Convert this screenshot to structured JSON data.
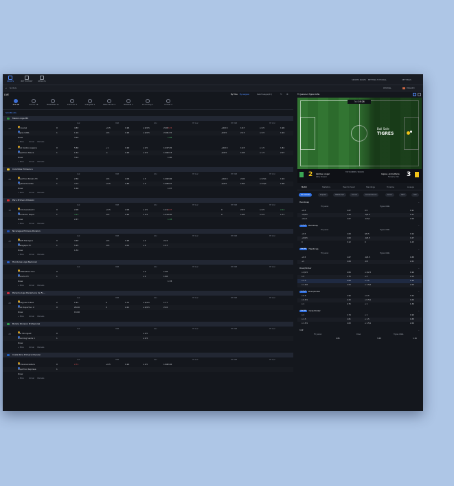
{
  "nav": {
    "sports": "SPORTS",
    "bet_history": "BET HISTORY",
    "results": "RESULTS",
    "sports_rules": "SPORTS RULES",
    "betting_tutorial": "BETTING TUTORIAL",
    "settings": "SETTINGS",
    "no_bets": "No Bets",
    "odds_format": "DECIMAL",
    "language": "ENGLISH"
  },
  "live": {
    "title": "LIVE",
    "sort": "By Time",
    "sort_alt": "By Leagues",
    "select_league": "Select League(11)",
    "soccer_label": "SOCCER (18)"
  },
  "sport_tabs": [
    {
      "label": "ALL 38",
      "active": true
    },
    {
      "label": "Soccer 18"
    },
    {
      "label": "Basketball 11"
    },
    {
      "label": "E-Soccer 4"
    },
    {
      "label": "Volleyball 1"
    },
    {
      "label": "Table Tennis 4"
    },
    {
      "label": "Baseball 1"
    },
    {
      "label": "Ice Hockey 1"
    },
    {
      "label": "Cricket 3"
    }
  ],
  "col_headers": [
    "1x2",
    "HDP",
    "O/U",
    "HT 1x2",
    "HT HDP",
    "HT O/U"
  ],
  "more_label": "+ More",
  "corner_label": "Corner",
  "intervals_label": "Intervals",
  "leagues": [
    {
      "name": "Mexico Liga MX",
      "matches": [
        {
          "time": "2H 74:30",
          "home": "FC Juarez",
          "away": "Tigres UANL",
          "hs": "0",
          "as": "1",
          "r1": [
            "4.83",
            "",
            "+0.5",
            "1.96",
            "o 2/2.5",
            "2.06",
            "3.15",
            "",
            "+0/0.5",
            "1.67",
            "o 0.5",
            "1.96"
          ],
          "r2": [
            "1.16",
            "",
            "-0.5",
            "1.96",
            "u 2/2.5",
            "2.06",
            "1.55",
            "",
            "-0/0.5",
            "2.23",
            "u 0.5",
            "1.94"
          ],
          "draw": [
            "3.29",
            "",
            "",
            "",
            "",
            "",
            "1.68",
            "",
            "",
            "",
            "",
            ""
          ]
        },
        {
          "time": "2H 36:30",
          "home": "Club Santos Laguna",
          "away": "Deportivo Toluca",
          "hs": "0",
          "as": "1",
          "r1": [
            "5.80",
            "",
            "+1",
            "1.99",
            "o 2.5",
            "1.92",
            "7.05",
            "",
            "+0/0.5",
            "1.93",
            "o 1.5",
            "1.81"
          ],
          "r2": [
            "1.54",
            "",
            "-1",
            "1.99",
            "u 2.5",
            "1.96",
            "2.53",
            "",
            "-0/0.5",
            "1.98",
            "u 1.5",
            "2.07"
          ],
          "draw": [
            "3.14",
            "",
            "",
            "",
            "",
            "",
            "1.90",
            "",
            "",
            "",
            "",
            ""
          ]
        }
      ]
    },
    {
      "name": "Colombia Primera A",
      "matches": [
        {
          "time": "2H 09:30",
          "home": "Deportivo Pereira FC",
          "away": "Aguilas Doradas",
          "hs": "0",
          "as": "1",
          "r1": [
            "2.56",
            "",
            "-0.5",
            "2.06",
            "o 3",
            "1.96",
            "2.86",
            "",
            "+0/0.5",
            "2.06",
            "o 0.5/1",
            "1.94"
          ],
          "r2": [
            "3.72",
            "",
            "+0.5",
            "1.86",
            "u 3",
            "1.98",
            "3.87",
            "",
            "-0/0.5",
            "1.86",
            "u 0.5/1",
            "1.96"
          ],
          "draw": [
            "1.60",
            "",
            "",
            "",
            "",
            "",
            "1.97",
            "",
            "",
            "",
            "",
            ""
          ]
        }
      ]
    },
    {
      "name": "Peru Primera Division",
      "matches": [
        {
          "time": "1H 33:00",
          "home": "CD Universidad C",
          "away": "Asociacion Depor",
          "hs": "0",
          "as": "1",
          "r1": [
            "2.06",
            "",
            "+0.5",
            "2.06",
            "o 1.5",
            "1.91",
            "4.07",
            "",
            "0",
            "2.45",
            "o 0.5",
            "2.14"
          ],
          "r2": [
            "4.11",
            "",
            "-0.5",
            "1.92",
            "u 1.5",
            "1.91",
            "4.60",
            "",
            "0",
            "1.96",
            "u 0.5",
            "1.71"
          ],
          "draw": [
            "2.47",
            "",
            "",
            "",
            "",
            "",
            "1.38",
            "",
            "",
            "",
            "",
            ""
          ]
        }
      ]
    },
    {
      "name": "Nicaragua Primera Division",
      "matches": [
        {
          "time": "2H 76:30",
          "home": "UNAN Managua",
          "away": "Matagalpa FC",
          "hs": "0",
          "as": "1",
          "r1": [
            "3.48",
            "",
            "-0.5",
            "1.96",
            "o 2",
            "2.22",
            "",
            "",
            "",
            "",
            "",
            ""
          ],
          "r2": [
            "5.25",
            "",
            "-0.5",
            "2.01",
            "u 2",
            "1.57",
            "",
            "",
            "",
            "",
            "",
            ""
          ],
          "draw": [
            "1.32",
            "",
            "",
            "",
            "",
            "",
            "",
            "",
            "",
            "",
            "",
            ""
          ]
        }
      ]
    },
    {
      "name": "Honduras Liga Nacional",
      "matches": [
        {
          "time": "",
          "home": "CD Marathon San",
          "away": "Olancho FC",
          "hs": "0",
          "as": "1",
          "r1": [
            "",
            "",
            "",
            "",
            "o 2",
            "1.96",
            "",
            "",
            "",
            "",
            "",
            ""
          ],
          "r2": [
            "",
            "",
            "",
            "",
            "u 2",
            "1.86",
            "",
            "",
            "",
            "",
            "",
            ""
          ],
          "draw": [
            "",
            "",
            "",
            "",
            "",
            "",
            "1.78",
            "",
            "",
            "",
            "",
            ""
          ]
        }
      ]
    },
    {
      "name": "Panama Liga Panamena de Fu...",
      "matches": [
        {
          "time": "2H 65:30",
          "home": "Veraguas United",
          "away": "Club Deportivo U",
          "hs": "2",
          "as": "0",
          "r1": [
            "1.61",
            "",
            "0",
            "1.72",
            "o 2/2.5",
            "1.77",
            "",
            "",
            "",
            "",
            "",
            ""
          ],
          "r2": [
            "28.00",
            "",
            "0",
            "2.21",
            "u 2/2.5",
            "2.02",
            "",
            "",
            "",
            "",
            "",
            ""
          ],
          "draw": [
            "13.60",
            "",
            "",
            "",
            "",
            "",
            "",
            "",
            "",
            "",
            "",
            ""
          ]
        }
      ]
    },
    {
      "name": "Bolivia Division Profesional",
      "matches": [
        {
          "time": "2H 79:00",
          "home": "The Strongest",
          "away": "Blooming Santa C",
          "hs": "0",
          "as": "1",
          "r1": [
            "",
            "",
            "",
            "",
            "o 2.5",
            "",
            "",
            "",
            "",
            "",
            "",
            ""
          ],
          "r2": [
            "",
            "",
            "",
            "",
            "u 2.5",
            "",
            "",
            "",
            "",
            "",
            "",
            ""
          ],
          "draw": [
            "",
            "",
            "",
            "",
            "",
            "",
            "",
            "",
            "",
            "",
            "",
            ""
          ]
        }
      ]
    },
    {
      "name": "Costa Rica Primera Division",
      "matches": [
        {
          "time": "",
          "home": "AD Guanacasteca",
          "away": "Deportivo Saprissa",
          "hs": "0",
          "as": "1",
          "r1": [
            "2.71",
            "",
            "+0.5",
            "1.94",
            "o 2.5",
            "1.88",
            "2.06",
            "",
            "",
            "",
            "",
            ""
          ],
          "r2": [
            "",
            "",
            "",
            "",
            "",
            "",
            "",
            "",
            "",
            "",
            "",
            ""
          ],
          "draw": [
            "",
            "",
            "",
            "",
            "",
            "",
            "",
            "",
            "",
            "",
            "",
            ""
          ]
        }
      ]
    }
  ],
  "live_match": {
    "title": "FC Juarez vs Tigres UANL",
    "clock_label": "Tail",
    "clock": "19:26",
    "event_line1": "Ball Safe",
    "event_line2": "TIGRES",
    "home_score": "2",
    "away_score": "3",
    "stat_label": "TOP SCORERS / SEASON",
    "home_player": "Zaldivar, Angel",
    "home_player_info": "#29 | Forward",
    "away_player": "Gignac, Andre Pierre",
    "away_player_info": "Forward | #10"
  },
  "right_tabs": [
    "Match",
    "Statistics",
    "Head to head",
    "Standings",
    "Timeline",
    "Lineups"
  ],
  "market_pills": [
    "All markets",
    "Popular",
    "HDP & O/U",
    "Corner",
    "Correct Score",
    "Score",
    "Half",
    "Inte"
  ],
  "markets": [
    {
      "title": "Handicap",
      "badge": "",
      "home": "FC Juarez",
      "away": "Tigres UANL",
      "rows": [
        [
          "+0.5",
          "1.67",
          "0.5",
          "1.91"
        ],
        [
          "+0/0.5",
          "2.23",
          "-0/0.5",
          "1.51"
        ],
        [
          "+0/+1",
          "1.67",
          "-0.5/1",
          "2.29"
        ]
      ]
    },
    {
      "title": "Handicap",
      "badge": "1st Half",
      "home": "FC Juarez",
      "away": "Tigres UANL",
      "rows": [
        [
          "+0.5",
          "1.69",
          "0/0.5",
          "1.94"
        ],
        [
          "+0/0.5",
          "2.00",
          "-0/0.5",
          "1.67"
        ],
        [
          "0",
          "3.12",
          "0",
          "1.25"
        ]
      ]
    },
    {
      "title": "Handicap",
      "badge": "2nd Half",
      "home": "FC Juarez",
      "away": "Tigres UANL",
      "rows": [
        [
          "+0.5",
          "1.67",
          "-0/0.5",
          "1.88"
        ],
        [
          "+1",
          "1.64",
          "-0.5",
          "2.21"
        ]
      ]
    },
    {
      "title": "Over/Under",
      "badge": "",
      "home": "",
      "away": "",
      "rows": [
        [
          "o 2/2.5",
          "2.06",
          "u 2/2.5",
          "1.96"
        ],
        [
          "o 2",
          "1.75",
          "u 2",
          "2.14"
        ],
        [
          "o 2.5",
          "2.68",
          "u 2.5",
          "1.46"
        ],
        [
          "o 1.5/2",
          "1.53",
          "u 1.5/2",
          "2.29"
        ]
      ]
    },
    {
      "title": "Over/Under",
      "badge": "1st Half",
      "home": "",
      "away": "",
      "rows": [
        [
          "o 0.5",
          "1.96",
          "u 0.5",
          "1.94"
        ],
        [
          "o 0.5/1",
          "2.20",
          "u 0.5/1",
          "1.66"
        ],
        [
          "o 1",
          "2.75",
          "u 1",
          "1.39"
        ]
      ]
    },
    {
      "title": "Over/Under",
      "badge": "2nd Half",
      "home": "",
      "away": "",
      "rows": [
        [
          "o 1",
          "1.74",
          "u 1",
          "1.96"
        ],
        [
          "o 1.5",
          "1.81",
          "u 1.5",
          "1.88"
        ],
        [
          "o 1.5/1",
          "1.63",
          "u 1.5/1",
          "2.26"
        ]
      ]
    },
    {
      "title": "1x2",
      "badge": "",
      "home": "FC Juarez",
      "away": "Tigres UANL",
      "rows": [
        [
          "",
          "4.81",
          "3.29",
          "1.16"
        ]
      ]
    }
  ],
  "draw_header": "Draw",
  "colors": {
    "accent": "#2f6fe0",
    "up": "#4fc16a",
    "down": "#e05353",
    "bg": "#14171d"
  }
}
